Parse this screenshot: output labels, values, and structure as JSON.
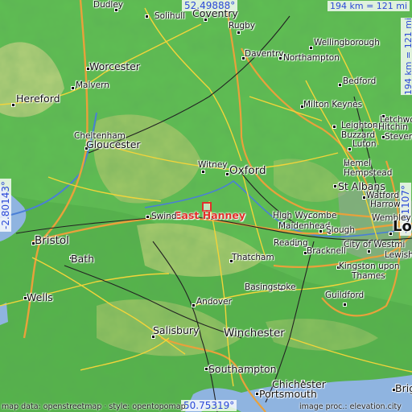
{
  "coords": {
    "top_lat": "52.49888°",
    "bottom_lat": "50.75319°",
    "left_lon": "-2.80143°",
    "right_lon": "-0.01107°"
  },
  "scale": {
    "horizontal": "194 km = 121 mi",
    "vertical": "194 km = 121 mi"
  },
  "focus_place": "East Hanney",
  "places": {
    "dudley": "Dudley",
    "solihull": "Solihull",
    "coventry": "Coventry",
    "rugby": "Rugby",
    "wellingborough": "Wellingborough",
    "daventry": "Daventry",
    "northampton": "Northampton",
    "worcester": "Worcester",
    "bedford": "Bedford",
    "malvern": "Malvern",
    "hereford": "Hereford",
    "milton_keynes": "Milton Keynes",
    "letchworth": "Letchworth",
    "hitchin": "Hitchin",
    "leighton_buzzard": "Leighton Buzzard",
    "stevenage": "Stevena",
    "cheltenham": "Cheltenham",
    "gloucester": "Gloucester",
    "luton": "Luton",
    "hemel_hempstead": "Hemel Hempstead",
    "witney": "Witney",
    "oxford": "Oxford",
    "st_albans": "St Albans",
    "watford": "Watford",
    "harrow": "Harrow",
    "wembley": "Wembley",
    "swindon": "Swind",
    "high_wycombe": "High Wycombe",
    "maidenhead": "Maidenhead",
    "slough": "Slough",
    "london": "Lo",
    "bristol": "Bristol",
    "reading": "Reading",
    "bracknell": "Bracknell",
    "city_of_westminster": "City of Westmi",
    "bath": "Bath",
    "thatcham": "Thatcham",
    "lewisham": "Lewish",
    "kingston": "Kingston upon",
    "thames": "Thames",
    "basingstoke": "Basingstoke",
    "wells": "Wells",
    "andover": "Andover",
    "guildford": "Guildford",
    "salisbury": "Salisbury",
    "winchester": "Winchester",
    "southampton": "Southampton",
    "chichester": "Chichester",
    "portsmouth": "Portsmouth",
    "brighton": "Brig"
  },
  "credits": {
    "left": "map data: openstreetmap · style: opentopomap",
    "right": "image proc.: elevation.city"
  },
  "colors": {
    "focus": "#e0302a",
    "coord_text": "#2b49d8",
    "sea": "#8fb4e0",
    "lowland": "#5fbf52",
    "upland": "#b9cf74",
    "road": "#f2d43a",
    "motorway": "#e9a13b",
    "rail": "#222222"
  }
}
